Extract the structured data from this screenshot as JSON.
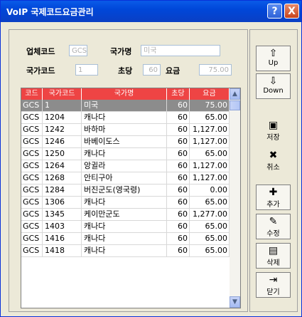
{
  "window": {
    "title": "VoIP 국제코드요금관리"
  },
  "form": {
    "company_label": "업체코드",
    "company_value": "GCS",
    "country_name_label": "국가명",
    "country_name_value": "미국",
    "country_code_label": "국가코드",
    "country_code_value": "1",
    "per_sec_label": "초당",
    "per_sec_value": "60",
    "rate_label": "요금",
    "rate_value": "75.00"
  },
  "table": {
    "headers": [
      "코드",
      "국가코드",
      "국가명",
      "초당",
      "요금"
    ],
    "rows": [
      [
        "GCS",
        "1",
        "미국",
        "60",
        "75.00"
      ],
      [
        "GCS",
        "1204",
        "캐나다",
        "60",
        "65.00"
      ],
      [
        "GCS",
        "1242",
        "바하마",
        "60",
        "1,127.00"
      ],
      [
        "GCS",
        "1246",
        "바베이도스",
        "60",
        "1,127.00"
      ],
      [
        "GCS",
        "1250",
        "캐나다",
        "60",
        "65.00"
      ],
      [
        "GCS",
        "1264",
        "앙귈라",
        "60",
        "1,127.00"
      ],
      [
        "GCS",
        "1268",
        "안티구아",
        "60",
        "1,127.00"
      ],
      [
        "GCS",
        "1284",
        "버진군도(영국령)",
        "60",
        "0.00"
      ],
      [
        "GCS",
        "1306",
        "캐나다",
        "60",
        "65.00"
      ],
      [
        "GCS",
        "1345",
        "케이만군도",
        "60",
        "1,277.00"
      ],
      [
        "GCS",
        "1403",
        "캐나다",
        "60",
        "65.00"
      ],
      [
        "GCS",
        "1416",
        "캐나다",
        "60",
        "65.00"
      ],
      [
        "GCS",
        "1418",
        "캐나다",
        "60",
        "65.00"
      ]
    ]
  },
  "side": {
    "up": "Up",
    "down": "Down",
    "save": "저장",
    "cancel": "취소",
    "add": "추가",
    "edit": "수정",
    "delete": "삭제",
    "close": "닫기"
  },
  "icons": {
    "help": "?",
    "close": "X"
  }
}
